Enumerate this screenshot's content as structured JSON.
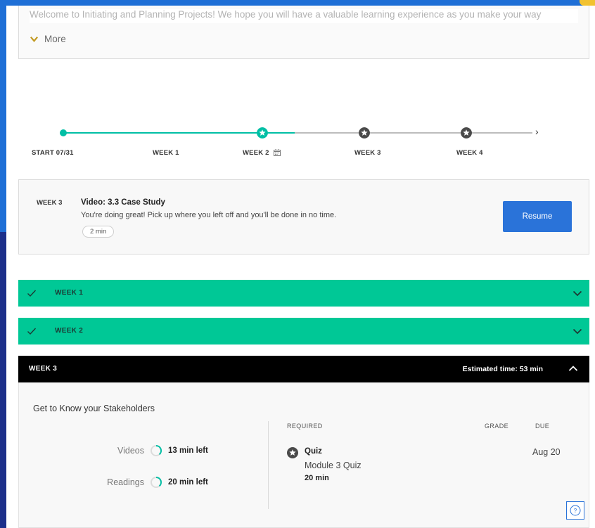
{
  "welcome": {
    "text": "Welcome to Initiating and Planning Projects! We hope you will have a valuable learning experience as you make your way",
    "more_label": "More"
  },
  "timeline": {
    "start_label": "START 07/31",
    "weeks": [
      "WEEK 1",
      "WEEK 2",
      "WEEK 3",
      "WEEK 4"
    ],
    "arrow": "›"
  },
  "resume": {
    "week": "WEEK 3",
    "title": "Video: 3.3 Case Study",
    "description": "You're doing great! Pick up where you left off and you'll be done in no time.",
    "duration": "2 min",
    "button_label": "Resume"
  },
  "weeks": [
    {
      "label": "WEEK 1",
      "completed": true
    },
    {
      "label": "WEEK 2",
      "completed": true
    },
    {
      "label": "WEEK 3",
      "completed": false,
      "estimated": "Estimated time: 53 min"
    }
  ],
  "week3": {
    "module_title": "Get to Know your Stakeholders",
    "stats": [
      {
        "label": "Videos",
        "value": "13 min left"
      },
      {
        "label": "Readings",
        "value": "20 min left"
      }
    ],
    "columns": {
      "required": "REQUIRED",
      "grade": "GRADE",
      "due": "DUE"
    },
    "item": {
      "type": "Quiz",
      "name": "Module 3 Quiz",
      "time": "20 min",
      "due": "Aug 20"
    }
  },
  "help": {
    "label": "?"
  },
  "colors": {
    "accent_green": "#00c896",
    "timeline_green": "#00bfa5",
    "button_blue": "#2a73d9",
    "frame_blue": "#1f6fd6"
  }
}
